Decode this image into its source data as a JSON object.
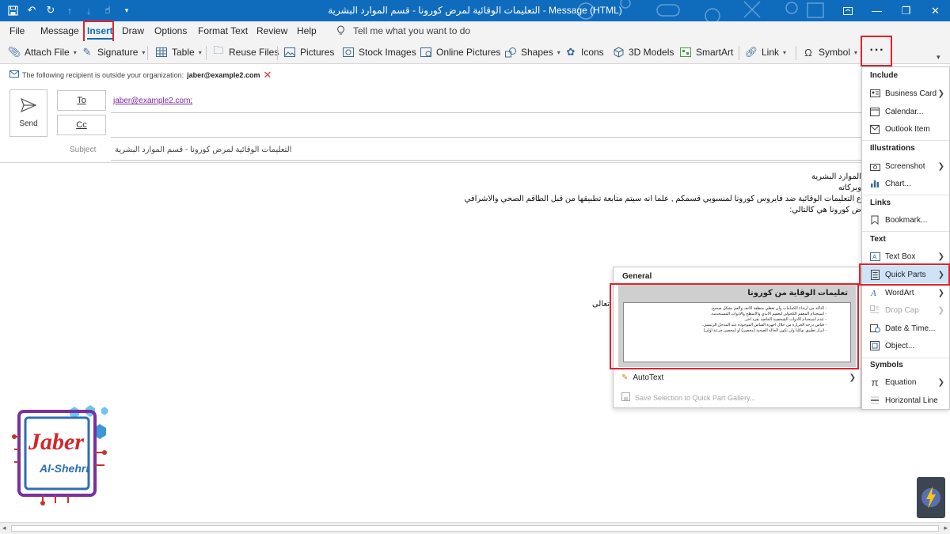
{
  "window": {
    "title": "التعليمات الوقائية لمرض كورونا - قسم الموارد البشرية  -  Message (HTML)",
    "qat_icons": [
      "save-icon",
      "undo-icon",
      "redo-icon",
      "up-arrow-icon",
      "down-arrow-icon",
      "touch-mode-icon",
      "customize-qat-icon"
    ],
    "controls": [
      "restore-ribbon-icon",
      "minimize-icon",
      "maximize-icon",
      "close-icon"
    ]
  },
  "tabs": [
    {
      "label": "File"
    },
    {
      "label": "Message"
    },
    {
      "label": "Insert",
      "active": true
    },
    {
      "label": "Draw"
    },
    {
      "label": "Options"
    },
    {
      "label": "Format Text"
    },
    {
      "label": "Review"
    },
    {
      "label": "Help"
    }
  ],
  "tell_me": "Tell me what you want to do",
  "ribbon": {
    "attach_file": "Attach File",
    "signature": "Signature",
    "table": "Table",
    "reuse_files": "Reuse Files",
    "pictures": "Pictures",
    "stock_images": "Stock Images",
    "online_pictures": "Online Pictures",
    "shapes": "Shapes",
    "icons": "Icons",
    "models_3d": "3D Models",
    "smartart": "SmartArt",
    "link": "Link",
    "symbol": "Symbol",
    "more": "···"
  },
  "infobar": {
    "text": "The following recipient is outside your organization:",
    "email": "jaber@example2.com"
  },
  "compose": {
    "send": "Send",
    "to_label": "To",
    "cc_label": "Cc",
    "to_value": "jaber@example2.com;",
    "subject_label": "Subject",
    "subject_value": "التعليمات الوقائية لمرض كورونا - قسم الموارد البشرية"
  },
  "body": {
    "lines": [
      "الموارد البشرية",
      "وبركاته",
      "ع التعليمات الوقائية ضد فايروس كورونا لمنسوبي قسمكم , علما انه سيتم متابعة تطبيقها من قبل الطاقم الصحي والاشرافي",
      "ض كورونا هي كالتالي:",
      "تعالى"
    ]
  },
  "quick_parts_gallery": {
    "section": "General",
    "entry_title": "تعليمات الوقاية من كورونا",
    "preview_lines": [
      "- التأكد من ارتداء الكمامات وأن تغطي منطقة الانف والفم بشكل صحيح.",
      "- استخدام المعقم الكحولي لتعقيم الايدي والاسطح والادوات المستخدمة.",
      "- عدم استخدام الادوات الشخصية الخاصة بفرد اخر.",
      "- قياس درجة الحرارة من خلال اجهزة القياس الموجودة عند المدخل الرئيسي.",
      "- ابراز تطبيق توكلنا وان تكون الحالة الصحية (محصن) او (محصن جرعة أولى)"
    ],
    "autotext": "AutoText",
    "save_selection": "Save Selection to Quick Part Gallery..."
  },
  "insert_menu": {
    "sections": [
      {
        "header": "Include",
        "items": [
          {
            "label": "Business Card",
            "icon": "business-card-icon",
            "submenu": true
          },
          {
            "label": "Calendar...",
            "icon": "calendar-icon"
          },
          {
            "label": "Outlook Item",
            "icon": "outlook-item-icon"
          }
        ]
      },
      {
        "header": "Illustrations",
        "items": [
          {
            "label": "Screenshot",
            "icon": "screenshot-icon",
            "submenu": true
          },
          {
            "label": "Chart...",
            "icon": "chart-icon"
          }
        ]
      },
      {
        "header": "Links",
        "items": [
          {
            "label": "Bookmark...",
            "icon": "bookmark-icon"
          }
        ]
      },
      {
        "header": "Text",
        "items": [
          {
            "label": "Text Box",
            "icon": "text-box-icon",
            "submenu": true
          },
          {
            "label": "Quick Parts",
            "icon": "quick-parts-icon",
            "submenu": true,
            "selected": true
          },
          {
            "label": "WordArt",
            "icon": "wordart-icon",
            "submenu": true
          },
          {
            "label": "Drop Cap",
            "icon": "drop-cap-icon",
            "submenu": true,
            "disabled": true
          },
          {
            "label": "Date & Time...",
            "icon": "date-time-icon"
          },
          {
            "label": "Object...",
            "icon": "object-icon"
          }
        ]
      },
      {
        "header": "Symbols",
        "items": [
          {
            "label": "Equation",
            "icon": "equation-icon",
            "submenu": true
          },
          {
            "label": "Horizontal Line",
            "icon": "horizontal-line-icon"
          }
        ]
      }
    ]
  },
  "logo": {
    "line1": "Jaber",
    "line2": "Al-Shehri"
  },
  "colors": {
    "title_bar": "#0f6cbd",
    "accent": "#0f6cbd",
    "highlight_box": "#e0232e",
    "menu_selected": "#cfe3f7"
  }
}
